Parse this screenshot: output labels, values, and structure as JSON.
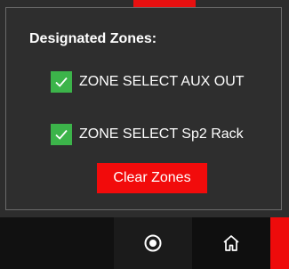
{
  "flyout": {
    "title": "Designated Zones:",
    "zones": [
      {
        "label": "ZONE SELECT AUX OUT",
        "checked": true,
        "icon": "checkmark-icon"
      },
      {
        "label": "ZONE SELECT Sp2 Rack",
        "checked": true,
        "icon": "checkmark-icon"
      }
    ],
    "clear_button_label": "Clear Zones"
  },
  "taskbar": {
    "buttons": [
      {
        "name": "record",
        "icon": "record-circle-icon"
      },
      {
        "name": "home",
        "icon": "home-icon"
      }
    ]
  },
  "colors": {
    "checkbox": "#3cb44a",
    "clear_button": "#f20b0b",
    "panel_background": "#2e2e2e",
    "taskbar_background": "#111111"
  }
}
